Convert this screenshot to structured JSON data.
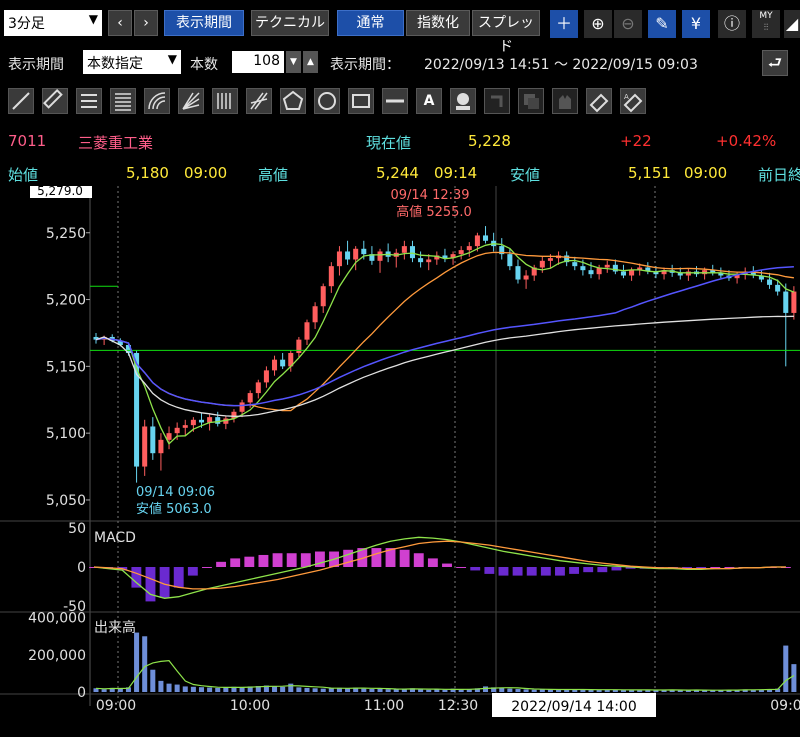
{
  "toolbar": {
    "timeframe": "3分足",
    "period_btn": "表示期間",
    "tech_btn": "テクニカル",
    "normal_btn": "通常",
    "index_btn": "指数化",
    "spread_btn": "スプレッド"
  },
  "period_row": {
    "label": "表示期間",
    "mode": "本数指定",
    "count_label": "本数",
    "count_value": "108",
    "range_label": "表示期間：",
    "range_value": "2022/09/13 14:51 ～ 2022/09/15 09:03"
  },
  "quote": {
    "code": "7011",
    "name": "三菱重工業",
    "current_label": "現在値",
    "current_value": "5,228",
    "change": "+22",
    "change_pct": "+0.42%",
    "open_label": "始値",
    "open_value": "5,180",
    "open_time": "09:00",
    "high_label": "高値",
    "high_value": "5,244",
    "high_time": "09:14",
    "low_label": "安値",
    "low_value": "5,151",
    "low_time": "09:00",
    "prev_label": "前日終"
  },
  "colors": {
    "up": "#ff5e5e",
    "down": "#67d4f0",
    "ma_short": "#8ee34a",
    "ma_mid": "#ff9a3c",
    "ma_long": "#5555ff",
    "vwap": "#e0e0e0",
    "ref_line": "#11dd11",
    "macd_hist": "#d040d0"
  },
  "chart_data": {
    "type": "candlestick",
    "price_ticks": [
      "5,250",
      "5,200",
      "5,150",
      "5,100",
      "5,050"
    ],
    "price_top_label": "5,279.0",
    "ylim": [
      5035,
      5285
    ],
    "time_ticks": [
      "09:00",
      "10:00",
      "11:00",
      "12:30",
      "09:0"
    ],
    "crosshair_time": "2022/09/14 14:00",
    "reference_price": 5162,
    "annotations": {
      "high": {
        "time": "09/14 12:39",
        "label": "高値 5255.0",
        "price": 5255
      },
      "low": {
        "time": "09/14 09:06",
        "label": "安値 5063.0",
        "price": 5063
      }
    },
    "candles": [
      [
        5172,
        5175,
        5167,
        5170
      ],
      [
        5170,
        5173,
        5166,
        5172
      ],
      [
        5172,
        5174,
        5168,
        5169
      ],
      [
        5169,
        5171,
        5165,
        5166
      ],
      [
        5166,
        5168,
        5158,
        5160
      ],
      [
        5160,
        5162,
        5063,
        5075
      ],
      [
        5075,
        5110,
        5068,
        5105
      ],
      [
        5105,
        5112,
        5080,
        5085
      ],
      [
        5085,
        5100,
        5072,
        5095
      ],
      [
        5095,
        5105,
        5088,
        5100
      ],
      [
        5100,
        5108,
        5095,
        5104
      ],
      [
        5104,
        5110,
        5098,
        5106
      ],
      [
        5106,
        5112,
        5101,
        5110
      ],
      [
        5110,
        5115,
        5104,
        5108
      ],
      [
        5108,
        5114,
        5102,
        5112
      ],
      [
        5112,
        5116,
        5105,
        5107
      ],
      [
        5107,
        5113,
        5103,
        5111
      ],
      [
        5111,
        5118,
        5108,
        5116
      ],
      [
        5116,
        5125,
        5112,
        5123
      ],
      [
        5123,
        5132,
        5119,
        5130
      ],
      [
        5130,
        5140,
        5126,
        5138
      ],
      [
        5138,
        5150,
        5134,
        5147
      ],
      [
        5147,
        5158,
        5143,
        5155
      ],
      [
        5155,
        5160,
        5148,
        5150
      ],
      [
        5150,
        5162,
        5146,
        5160
      ],
      [
        5160,
        5172,
        5157,
        5170
      ],
      [
        5170,
        5185,
        5166,
        5183
      ],
      [
        5183,
        5198,
        5178,
        5195
      ],
      [
        5195,
        5212,
        5190,
        5210
      ],
      [
        5210,
        5228,
        5205,
        5225
      ],
      [
        5225,
        5240,
        5218,
        5236
      ],
      [
        5236,
        5244,
        5226,
        5230
      ],
      [
        5230,
        5240,
        5222,
        5238
      ],
      [
        5238,
        5244,
        5230,
        5234
      ],
      [
        5234,
        5240,
        5226,
        5229
      ],
      [
        5229,
        5238,
        5220,
        5236
      ],
      [
        5236,
        5242,
        5228,
        5232
      ],
      [
        5232,
        5238,
        5224,
        5235
      ],
      [
        5235,
        5244,
        5230,
        5240
      ],
      [
        5240,
        5244,
        5228,
        5231
      ],
      [
        5231,
        5236,
        5224,
        5228
      ],
      [
        5228,
        5234,
        5222,
        5230
      ],
      [
        5230,
        5236,
        5226,
        5233
      ],
      [
        5233,
        5238,
        5228,
        5231
      ],
      [
        5231,
        5236,
        5226,
        5234
      ],
      [
        5234,
        5240,
        5230,
        5237
      ],
      [
        5237,
        5243,
        5232,
        5240
      ],
      [
        5240,
        5250,
        5236,
        5248
      ],
      [
        5248,
        5255,
        5242,
        5244
      ],
      [
        5244,
        5250,
        5236,
        5240
      ],
      [
        5240,
        5246,
        5230,
        5234
      ],
      [
        5234,
        5238,
        5222,
        5225
      ],
      [
        5225,
        5230,
        5212,
        5215
      ],
      [
        5215,
        5222,
        5208,
        5218
      ],
      [
        5218,
        5226,
        5214,
        5224
      ],
      [
        5224,
        5232,
        5220,
        5229
      ],
      [
        5229,
        5234,
        5224,
        5231
      ],
      [
        5231,
        5236,
        5226,
        5233
      ],
      [
        5233,
        5236,
        5225,
        5228
      ],
      [
        5228,
        5232,
        5222,
        5225
      ],
      [
        5225,
        5230,
        5218,
        5222
      ],
      [
        5222,
        5228,
        5216,
        5219
      ],
      [
        5219,
        5226,
        5215,
        5224
      ],
      [
        5224,
        5229,
        5220,
        5226
      ],
      [
        5226,
        5230,
        5219,
        5221
      ],
      [
        5221,
        5226,
        5216,
        5218
      ],
      [
        5218,
        5224,
        5214,
        5222
      ],
      [
        5222,
        5227,
        5218,
        5224
      ],
      [
        5224,
        5228,
        5219,
        5221
      ],
      [
        5221,
        5225,
        5216,
        5219
      ],
      [
        5219,
        5224,
        5215,
        5222
      ],
      [
        5222,
        5226,
        5217,
        5220
      ],
      [
        5220,
        5224,
        5215,
        5218
      ],
      [
        5218,
        5223,
        5214,
        5221
      ],
      [
        5221,
        5225,
        5217,
        5219
      ],
      [
        5219,
        5224,
        5215,
        5222
      ],
      [
        5222,
        5226,
        5218,
        5220
      ],
      [
        5220,
        5224,
        5216,
        5218
      ],
      [
        5218,
        5222,
        5214,
        5216
      ],
      [
        5216,
        5221,
        5212,
        5219
      ],
      [
        5219,
        5224,
        5215,
        5221
      ],
      [
        5221,
        5225,
        5216,
        5218
      ],
      [
        5218,
        5222,
        5213,
        5215
      ],
      [
        5215,
        5220,
        5208,
        5211
      ],
      [
        5211,
        5215,
        5203,
        5206
      ],
      [
        5206,
        5212,
        5150,
        5190
      ],
      [
        5190,
        5210,
        5185,
        5206
      ]
    ],
    "macd": {
      "label": "MACD",
      "ticks": [
        "50",
        "0",
        "-50"
      ],
      "ylim": [
        -55,
        55
      ],
      "macd": [
        0,
        -2,
        -4,
        -20,
        -35,
        -40,
        -38,
        -33,
        -28,
        -24,
        -20,
        -16,
        -12,
        -8,
        -4,
        0,
        5,
        10,
        16,
        22,
        28,
        33,
        36,
        38,
        37,
        35,
        32,
        28,
        24,
        20,
        17,
        14,
        11,
        8,
        6,
        4,
        2,
        1,
        0,
        -1,
        -2,
        -2,
        -3,
        -3,
        -2,
        -2,
        -1,
        -1,
        0,
        0
      ],
      "signal": [
        0,
        -1,
        -2,
        -8,
        -15,
        -22,
        -26,
        -28,
        -28,
        -27,
        -25,
        -22,
        -19,
        -16,
        -12,
        -8,
        -4,
        1,
        6,
        11,
        17,
        22,
        26,
        30,
        32,
        33,
        32,
        30,
        28,
        25,
        22,
        19,
        16,
        13,
        10,
        7,
        5,
        3,
        1,
        0,
        -1,
        -1,
        -2,
        -2,
        -2,
        -2,
        -1,
        -1,
        0,
        0
      ]
    },
    "volume": {
      "label": "出来高",
      "ticks": [
        "400,000",
        "200,000",
        "0"
      ],
      "ylim": [
        0,
        420000
      ],
      "values": [
        20000,
        15000,
        22000,
        18000,
        25000,
        320000,
        300000,
        120000,
        60000,
        45000,
        40000,
        30000,
        28000,
        26000,
        24000,
        22000,
        25000,
        28000,
        26000,
        30000,
        32000,
        35000,
        30000,
        28000,
        45000,
        25000,
        22000,
        20000,
        18000,
        20000,
        22000,
        20000,
        24000,
        18000,
        16000,
        18000,
        15000,
        14000,
        16000,
        20000,
        15000,
        12000,
        14000,
        12000,
        18000,
        14000,
        16000,
        20000,
        30000,
        25000,
        22000,
        18000,
        16000,
        14000,
        12000,
        15000,
        14000,
        13000,
        12000,
        14000,
        13000,
        12000,
        11000,
        13000,
        12000,
        11000,
        10000,
        12000,
        11000,
        10000,
        12000,
        11000,
        10000,
        9000,
        11000,
        10000,
        9000,
        10000,
        11000,
        12000,
        14000,
        13000,
        12000,
        15000,
        18000,
        250000,
        150000
      ]
    }
  }
}
